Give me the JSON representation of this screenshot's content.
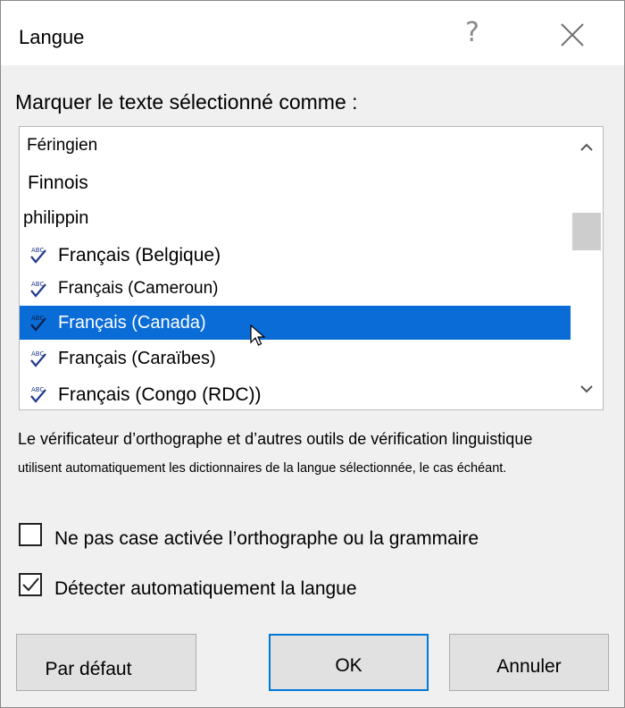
{
  "window": {
    "title": "Langue",
    "help_glyph": "?"
  },
  "prompt": "Marquer le texte sélectionné comme :",
  "languages": [
    {
      "label": "Féringien",
      "spell_icon": false,
      "selected": false
    },
    {
      "label": "Finnois",
      "spell_icon": false,
      "selected": false
    },
    {
      "label": "philippin",
      "spell_icon": false,
      "selected": false
    },
    {
      "label": "Français (Belgique)",
      "spell_icon": true,
      "selected": false
    },
    {
      "label": "Français (Cameroun)",
      "spell_icon": true,
      "selected": false
    },
    {
      "label": "Français (Canada)",
      "spell_icon": true,
      "selected": true
    },
    {
      "label": "Français (Caraïbes)",
      "spell_icon": true,
      "selected": false
    },
    {
      "label": "Français (Congo (RDC))",
      "spell_icon": true,
      "selected": false
    }
  ],
  "description": {
    "line1": "Le vérificateur d’orthographe et d’autres outils de vérification linguistique",
    "line2": "utilisent automatiquement les dictionnaires de la langue sélectionnée, le cas échéant."
  },
  "options": {
    "no_proofing": {
      "label": "Ne pas case activée l’orthographe ou la grammaire",
      "checked": false
    },
    "auto_detect": {
      "label": "Détecter automatiquement la langue",
      "checked": true
    }
  },
  "buttons": {
    "default_label": "Par défaut",
    "ok_label": "OK",
    "cancel_label": "Annuler"
  },
  "colors": {
    "selection": "#0a6cd6",
    "button_face": "#e1e1e1",
    "dialog_bg": "#f0f0f0",
    "spell_check": "#1f3a8a"
  }
}
